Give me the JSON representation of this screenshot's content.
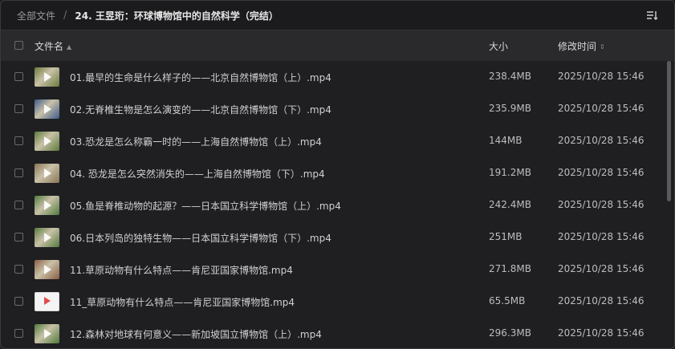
{
  "breadcrumb": {
    "root": "全部文件",
    "separator": "/",
    "current": "24. 王昱珩：环球博物馆中的自然科学（完结）"
  },
  "toolbar": {
    "sort_icon": "sort-list-icon"
  },
  "table": {
    "headers": {
      "name": "文件名",
      "size": "大小",
      "mtime": "修改时间"
    },
    "rows": [
      {
        "name": "01.最早的生命是什么样子的——北京自然博物馆（上）.mp4",
        "size": "238.4MB",
        "mtime": "2025/10/28 15:46",
        "thumb": "#6b7a3d"
      },
      {
        "name": "02.无脊椎生物是怎么演变的——北京自然博物馆（下）.mp4",
        "size": "235.9MB",
        "mtime": "2025/10/28 15:46",
        "thumb": "#3e5a8a"
      },
      {
        "name": "03.恐龙是怎么称霸一时的——上海自然博物馆（上）.mp4",
        "size": "144MB",
        "mtime": "2025/10/28 15:46",
        "thumb": "#5c7a3a"
      },
      {
        "name": "04. 恐龙是怎么突然消失的——上海自然博物馆（下）.mp4",
        "size": "191.2MB",
        "mtime": "2025/10/28 15:46",
        "thumb": "#8a7456"
      },
      {
        "name": "05.鱼是脊椎动物的起源？——日本国立科学博物馆（上）.mp4",
        "size": "242.4MB",
        "mtime": "2025/10/28 15:46",
        "thumb": "#4f7a3e"
      },
      {
        "name": "06.日本列岛的独特生物——日本国立科学博物馆（下）.mp4",
        "size": "251MB",
        "mtime": "2025/10/28 15:46",
        "thumb": "#567a3e"
      },
      {
        "name": "11.草原动物有什么特点——肯尼亚国家博物馆.mp4",
        "size": "271.8MB",
        "mtime": "2025/10/28 15:46",
        "thumb": "#8a5e45"
      },
      {
        "name": "11_草原动物有什么特点——肯尼亚国家博物馆.mp4",
        "size": "65.5MB",
        "mtime": "2025/10/28 15:46",
        "thumb": "video-file"
      },
      {
        "name": "12.森林对地球有何意义——新加坡国立博物馆（上）.mp4",
        "size": "296.3MB",
        "mtime": "2025/10/28 15:46",
        "thumb": "#4f7a3a"
      }
    ]
  }
}
